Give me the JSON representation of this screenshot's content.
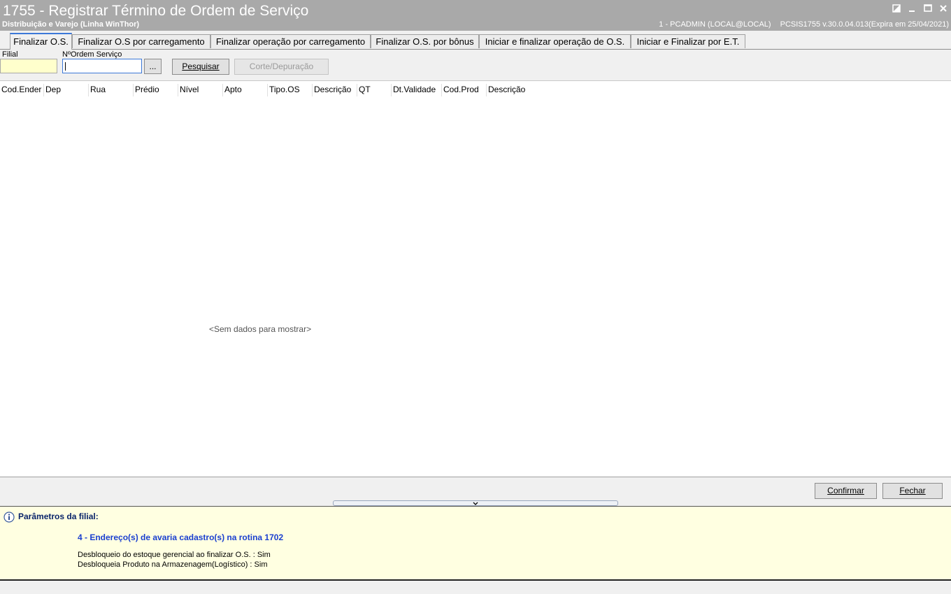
{
  "window": {
    "title": "1755 - Registrar Término de Ordem de Serviço",
    "subtitle": "Distribuição e Varejo (Linha WinThor)",
    "user": "1 - PCADMIN (LOCAL@LOCAL)",
    "version": "PCSIS1755  v.30.0.04.013(Expira em 25/04/2021)",
    "controls": [
      "restore-icon",
      "minimize-icon",
      "maximize-icon",
      "close-icon"
    ]
  },
  "tabs": [
    "Finalizar O.S.",
    "Finalizar O.S por carregamento",
    "Finalizar operação por carregamento",
    "Finalizar O.S. por bônus",
    "Iniciar e finalizar operação de O.S.",
    "Iniciar e Finalizar por E.T."
  ],
  "filters": {
    "filial_label": "Filial",
    "filial_value": "",
    "ordem_label": "NºOrdem Serviço",
    "ordem_value": "",
    "browse_label": "...",
    "search_label": "Pesquisar",
    "corte_label": "Corte/Depuração"
  },
  "grid": {
    "columns": [
      "Cod.Ender",
      "Dep",
      "Rua",
      "Prédio",
      "Nível",
      "Apto",
      "Tipo.OS",
      "Descrição",
      "QT",
      "Dt.Validade",
      "Cod.Prod",
      "Descrição"
    ],
    "empty_text": "<Sem dados para mostrar>"
  },
  "actions": {
    "confirm_label": "Confirmar",
    "close_label": "Fechar"
  },
  "params": {
    "title": "Parâmetros da filial:",
    "highlight": "4 - Endereço(s) de avaria cadastro(s) na rotina 1702",
    "lines": [
      "Desbloqueio do estoque gerencial ao finalizar O.S. : Sim",
      "Desbloqueia Produto na Armazenagem(Logístico) : Sim"
    ]
  },
  "colors": {
    "titlebar": "#a9a9a9",
    "active_tab_accent": "#3c78d8",
    "panel_yellow": "#ffffe1",
    "field_yellow": "#ffffcc",
    "focus_blue": "#3c78d8",
    "highlight_text": "#1a3fcf"
  }
}
